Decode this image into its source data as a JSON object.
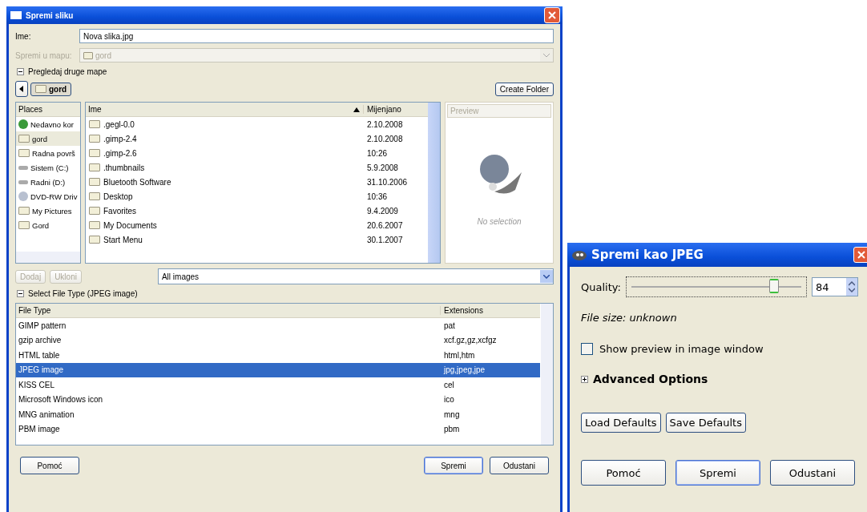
{
  "save_dialog": {
    "title": "Spremi sliku",
    "name_label": "Ime:",
    "name_value": "Nova slika.jpg",
    "folder_label": "Spremi u mapu:",
    "folder_value": "gord",
    "folder_disabled": true,
    "browse_toggle": {
      "label": "Pregledaj druge mape",
      "expanded": true
    },
    "path_button": "gord",
    "create_folder": "Create Folder",
    "places": {
      "header": "Places",
      "items": [
        {
          "label": "Nedavno kor",
          "kind": "recent",
          "selected": false
        },
        {
          "label": "gord",
          "kind": "folder",
          "selected": true
        },
        {
          "label": "Radna površ",
          "kind": "folder",
          "selected": false
        },
        {
          "label": "Sistem (C:)",
          "kind": "drive",
          "selected": false
        },
        {
          "label": "Radni (D:)",
          "kind": "drive",
          "selected": false
        },
        {
          "label": "DVD-RW Driv",
          "kind": "optical",
          "selected": false
        },
        {
          "label": "My Pictures",
          "kind": "folder",
          "selected": false
        },
        {
          "label": "Gord",
          "kind": "folder",
          "selected": false
        }
      ]
    },
    "files": {
      "columns": [
        "Ime",
        "Mijenjano"
      ],
      "rows": [
        {
          "name": ".gegl-0.0",
          "modified": "2.10.2008"
        },
        {
          "name": ".gimp-2.4",
          "modified": "2.10.2008"
        },
        {
          "name": ".gimp-2.6",
          "modified": "10:26"
        },
        {
          "name": ".thumbnails",
          "modified": "5.9.2008"
        },
        {
          "name": "Bluetooth Software",
          "modified": "31.10.2006"
        },
        {
          "name": "Desktop",
          "modified": "10:36"
        },
        {
          "name": "Favorites",
          "modified": "9.4.2009"
        },
        {
          "name": "My Documents",
          "modified": "20.6.2007"
        },
        {
          "name": "Start Menu",
          "modified": "30.1.2007"
        }
      ]
    },
    "preview": {
      "header": "Preview",
      "text": "No selection"
    },
    "add_button": "Dodaj",
    "remove_button": "Ukloni",
    "filter": "All images",
    "file_type_toggle": {
      "label": "Select File Type (JPEG image)",
      "expanded": true
    },
    "file_types": {
      "columns": [
        "File Type",
        "Extensions"
      ],
      "rows": [
        {
          "type": "GIMP pattern",
          "extensions": "pat",
          "selected": false
        },
        {
          "type": "gzip archive",
          "extensions": "xcf.gz,gz,xcfgz",
          "selected": false
        },
        {
          "type": "HTML table",
          "extensions": "html,htm",
          "selected": false
        },
        {
          "type": "JPEG image",
          "extensions": "jpg,jpeg,jpe",
          "selected": true
        },
        {
          "type": "KISS CEL",
          "extensions": "cel",
          "selected": false
        },
        {
          "type": "Microsoft Windows icon",
          "extensions": "ico",
          "selected": false
        },
        {
          "type": "MNG animation",
          "extensions": "mng",
          "selected": false
        },
        {
          "type": "PBM image",
          "extensions": "pbm",
          "selected": false
        }
      ]
    },
    "buttons": [
      "Pomoć",
      "Spremi",
      "Odustani"
    ]
  },
  "jpeg_dialog": {
    "title": "Spremi kao JPEG",
    "quality_label": "Quality:",
    "quality": {
      "level": 0.84,
      "value": "84"
    },
    "file_size": "File size: unknown",
    "show_preview": {
      "label": "Show preview in image window",
      "checked": false
    },
    "advanced": {
      "label": "Advanced Options",
      "expanded": false
    },
    "default_buttons": [
      "Load Defaults",
      "Save Defaults"
    ],
    "buttons": [
      "Pomoć",
      "Spremi",
      "Odustani"
    ]
  }
}
